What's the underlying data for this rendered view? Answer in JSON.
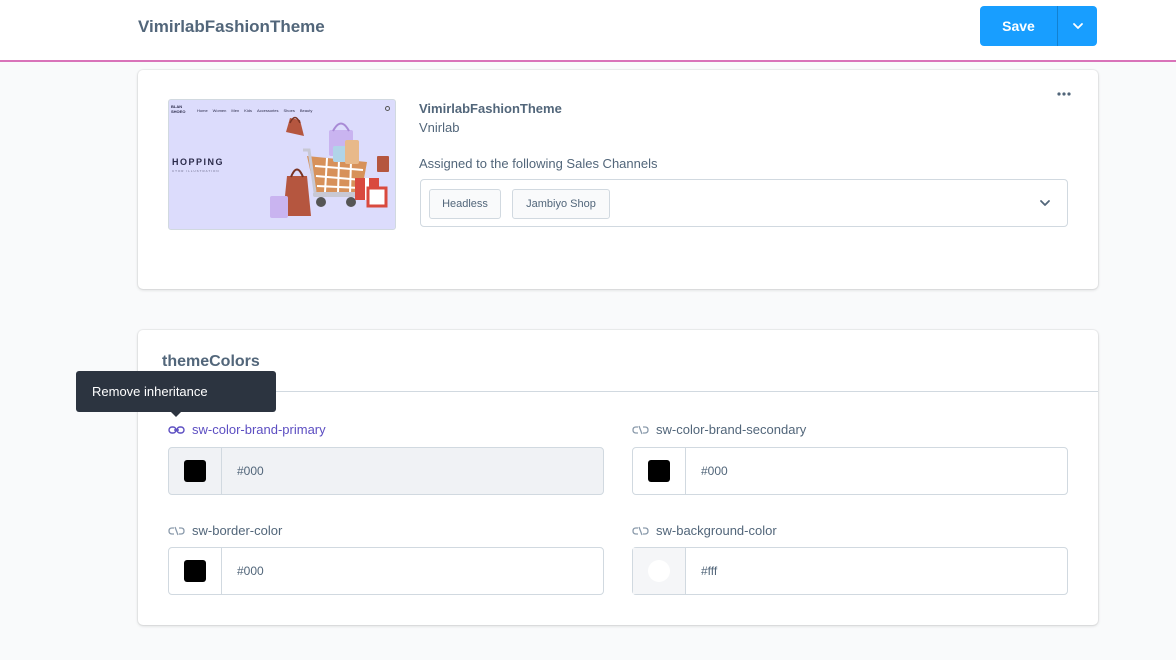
{
  "header": {
    "title": "VimirlabFashionTheme",
    "save_label": "Save",
    "split_icon": "chevron-down-icon"
  },
  "theme_card": {
    "preview": {
      "logo": "BLAN\nSHOEO",
      "nav": [
        "Home",
        "Women",
        "Men",
        "Kids",
        "Accessories",
        "Shoes",
        "Beauty"
      ],
      "headline": "HOPPING",
      "sub": "CTOR ILLUSTRATION"
    },
    "theme_name": "VimirlabFashionTheme",
    "author": "Vnirlab",
    "assigned_label": "Assigned to the following Sales Channels",
    "channels": [
      "Headless",
      "Jambiyo Shop"
    ],
    "more_icon": "more-horizontal-icon"
  },
  "colors_card": {
    "title": "themeColors",
    "fields": [
      {
        "label": "sw-color-brand-primary",
        "value": "#000",
        "swatch": "#000000",
        "inherited": false
      },
      {
        "label": "sw-color-brand-secondary",
        "value": "#000",
        "swatch": "#000000",
        "inherited": true
      },
      {
        "label": "sw-border-color",
        "value": "#000",
        "swatch": "#000000",
        "inherited": true
      },
      {
        "label": "sw-background-color",
        "value": "#fff",
        "swatch": "#ffffff",
        "inherited": true
      }
    ]
  },
  "tooltip": {
    "text": "Remove inheritance"
  },
  "colors": {
    "accent": "#189eff",
    "header_border": "#d973b9",
    "link_active": "#5c4ec2",
    "text": "#52667a"
  }
}
